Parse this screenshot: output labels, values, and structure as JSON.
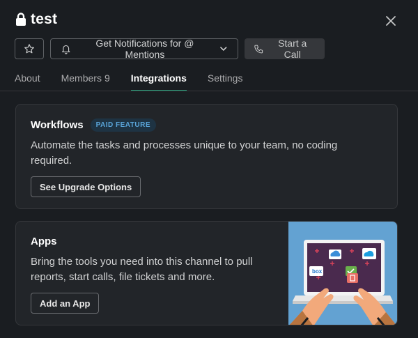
{
  "header": {
    "title": "test",
    "lock_icon": "lock-icon",
    "close_icon": "close-icon"
  },
  "actions": {
    "star_icon": "star-icon",
    "notifications_label": "Get Notifications for @ Mentions",
    "bell_icon": "bell-icon",
    "chevron_icon": "chevron-down-icon",
    "call_label": "Start a Call",
    "phone_icon": "phone-icon"
  },
  "tabs": [
    {
      "label": "About",
      "count": ""
    },
    {
      "label": "Members",
      "count": "9"
    },
    {
      "label": "Integrations",
      "count": ""
    },
    {
      "label": "Settings",
      "count": ""
    }
  ],
  "active_tab": "Integrations",
  "workflows": {
    "title": "Workflows",
    "badge": "PAID FEATURE",
    "description": "Automate the tasks and processes unique to your team, no coding required.",
    "button_label": "See Upgrade Options"
  },
  "apps": {
    "title": "Apps",
    "description": "Bring the tools you need into this channel to pull reports, start calls, file tickets and more.",
    "button_label": "Add an App",
    "illustration_labels": {
      "box": "box"
    }
  },
  "colors": {
    "background": "#1a1d21",
    "card": "#222529",
    "accent_tab": "#2ba37e",
    "badge_text": "#5aa5d9",
    "illustration_bg": "#63a2d2"
  }
}
